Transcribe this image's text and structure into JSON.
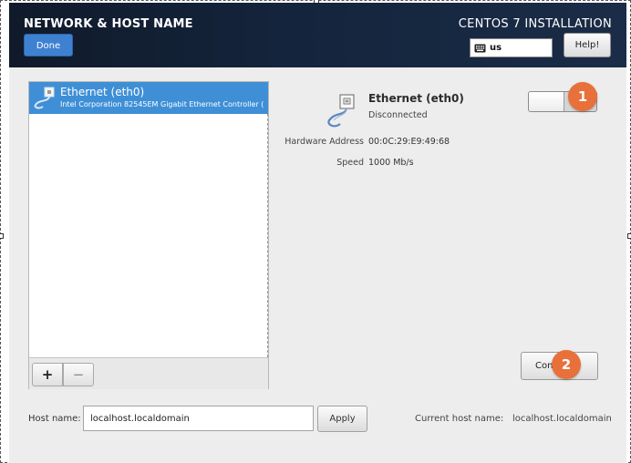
{
  "header": {
    "page_title": "NETWORK & HOST NAME",
    "done_label": "Done",
    "install_title": "CENTOS 7 INSTALLATION",
    "keyboard_layout": "us",
    "help_label": "Help!"
  },
  "connection_list": {
    "items": [
      {
        "name": "Ethernet (eth0)",
        "description": "Intel Corporation 82545EM Gigabit Ethernet Controller (",
        "icon": "network-cable-icon"
      }
    ],
    "add_label": "+",
    "remove_label": "−"
  },
  "detail": {
    "name": "Ethernet (eth0)",
    "status": "Disconnected",
    "hardware_address_label": "Hardware Address",
    "hardware_address_value": "00:0C:29:E9:49:68",
    "speed_label": "Speed",
    "speed_value": "1000 Mb/s",
    "toggle_on": false,
    "configure_label": "Con…"
  },
  "markers": [
    "1",
    "2"
  ],
  "hostname": {
    "label": "Host name:",
    "value": "localhost.localdomain",
    "apply_label": "Apply",
    "current_label": "Current host name:",
    "current_value": "localhost.localdomain"
  },
  "colors": {
    "header_bg": "#14243c",
    "accent_blue": "#3f81d1",
    "selection": "#3f8fd7",
    "marker": "#e8703a"
  }
}
